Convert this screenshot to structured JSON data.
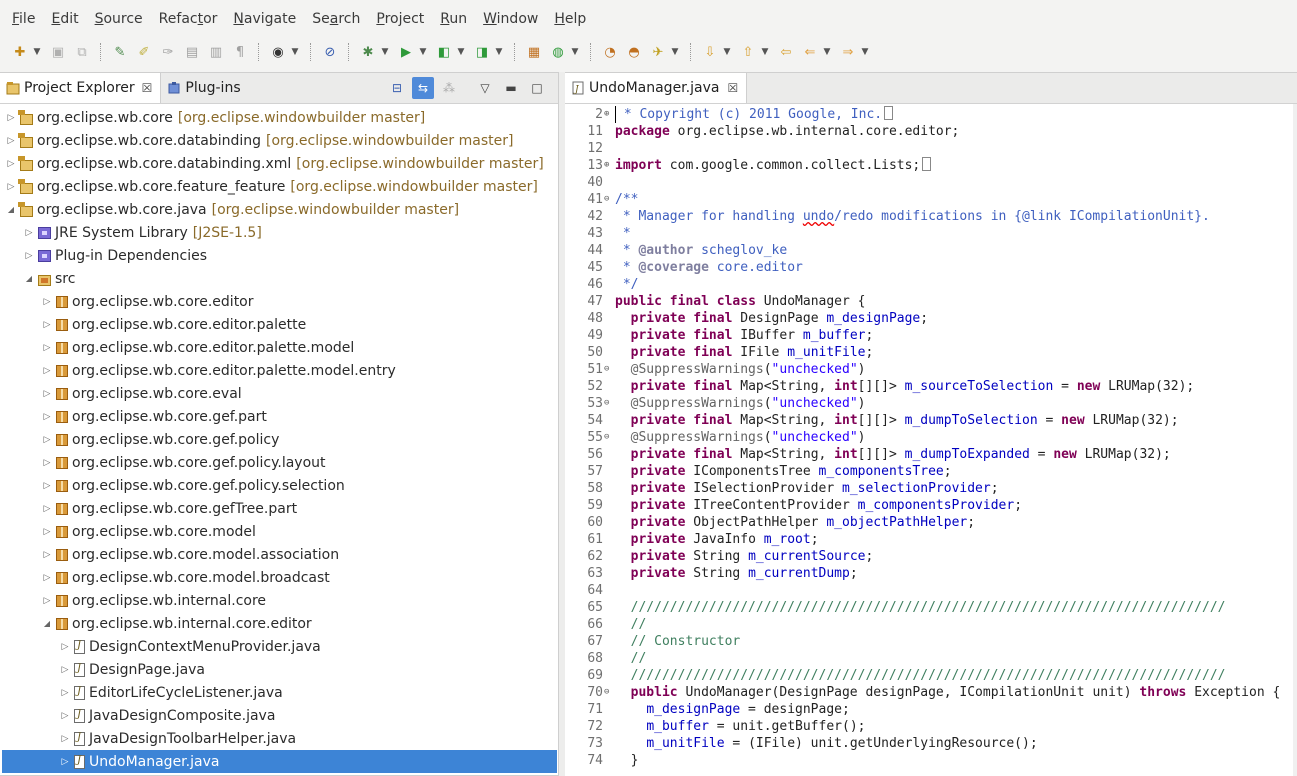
{
  "menubar": {
    "items": [
      {
        "before": "",
        "u": "F",
        "after": "ile"
      },
      {
        "before": "",
        "u": "E",
        "after": "dit"
      },
      {
        "before": "",
        "u": "S",
        "after": "ource"
      },
      {
        "before": "Refac",
        "u": "t",
        "after": "or"
      },
      {
        "before": "",
        "u": "N",
        "after": "avigate"
      },
      {
        "before": "Se",
        "u": "a",
        "after": "rch"
      },
      {
        "before": "",
        "u": "P",
        "after": "roject"
      },
      {
        "before": "",
        "u": "R",
        "after": "un"
      },
      {
        "before": "",
        "u": "W",
        "after": "indow"
      },
      {
        "before": "",
        "u": "H",
        "after": "elp"
      }
    ]
  },
  "left_view": {
    "tabs": [
      {
        "label": "Project Explorer",
        "icon": "project-explorer-icon",
        "active": true
      },
      {
        "label": "Plug-ins",
        "icon": "plugins-icon",
        "active": false
      }
    ],
    "tree": [
      {
        "depth": 0,
        "label": "org.eclipse.wb.core",
        "decoration": "[org.eclipse.windowbuilder master]",
        "icon": "project",
        "expanded": false
      },
      {
        "depth": 0,
        "label": "org.eclipse.wb.core.databinding",
        "decoration": "[org.eclipse.windowbuilder master]",
        "icon": "project",
        "expanded": false
      },
      {
        "depth": 0,
        "label": "org.eclipse.wb.core.databinding.xml",
        "decoration": "[org.eclipse.windowbuilder master]",
        "icon": "project",
        "expanded": false
      },
      {
        "depth": 0,
        "label": "org.eclipse.wb.core.feature_feature",
        "decoration": "[org.eclipse.windowbuilder master]",
        "icon": "project",
        "expanded": false
      },
      {
        "depth": 0,
        "label": "org.eclipse.wb.core.java",
        "decoration": "[org.eclipse.windowbuilder master]",
        "icon": "project",
        "expanded": true
      },
      {
        "depth": 1,
        "label": "JRE System Library",
        "decoration": "[J2SE-1.5]",
        "icon": "lib",
        "expanded": false
      },
      {
        "depth": 1,
        "label": "Plug-in Dependencies",
        "decoration": "",
        "icon": "lib",
        "expanded": false
      },
      {
        "depth": 1,
        "label": "src",
        "decoration": "",
        "icon": "src",
        "expanded": true
      },
      {
        "depth": 2,
        "label": "org.eclipse.wb.core.editor",
        "decoration": "",
        "icon": "pkg",
        "expanded": false
      },
      {
        "depth": 2,
        "label": "org.eclipse.wb.core.editor.palette",
        "decoration": "",
        "icon": "pkg",
        "expanded": false
      },
      {
        "depth": 2,
        "label": "org.eclipse.wb.core.editor.palette.model",
        "decoration": "",
        "icon": "pkg",
        "expanded": false
      },
      {
        "depth": 2,
        "label": "org.eclipse.wb.core.editor.palette.model.entry",
        "decoration": "",
        "icon": "pkg",
        "expanded": false
      },
      {
        "depth": 2,
        "label": "org.eclipse.wb.core.eval",
        "decoration": "",
        "icon": "pkg",
        "expanded": false
      },
      {
        "depth": 2,
        "label": "org.eclipse.wb.core.gef.part",
        "decoration": "",
        "icon": "pkg",
        "expanded": false
      },
      {
        "depth": 2,
        "label": "org.eclipse.wb.core.gef.policy",
        "decoration": "",
        "icon": "pkg",
        "expanded": false
      },
      {
        "depth": 2,
        "label": "org.eclipse.wb.core.gef.policy.layout",
        "decoration": "",
        "icon": "pkg",
        "expanded": false
      },
      {
        "depth": 2,
        "label": "org.eclipse.wb.core.gef.policy.selection",
        "decoration": "",
        "icon": "pkg",
        "expanded": false
      },
      {
        "depth": 2,
        "label": "org.eclipse.wb.core.gefTree.part",
        "decoration": "",
        "icon": "pkg",
        "expanded": false
      },
      {
        "depth": 2,
        "label": "org.eclipse.wb.core.model",
        "decoration": "",
        "icon": "pkg",
        "expanded": false
      },
      {
        "depth": 2,
        "label": "org.eclipse.wb.core.model.association",
        "decoration": "",
        "icon": "pkg",
        "expanded": false
      },
      {
        "depth": 2,
        "label": "org.eclipse.wb.core.model.broadcast",
        "decoration": "",
        "icon": "pkg",
        "expanded": false
      },
      {
        "depth": 2,
        "label": "org.eclipse.wb.internal.core",
        "decoration": "",
        "icon": "pkg",
        "expanded": false
      },
      {
        "depth": 2,
        "label": "org.eclipse.wb.internal.core.editor",
        "decoration": "",
        "icon": "pkg",
        "expanded": true
      },
      {
        "depth": 3,
        "label": "DesignContextMenuProvider.java",
        "decoration": "",
        "icon": "java",
        "expanded": false
      },
      {
        "depth": 3,
        "label": "DesignPage.java",
        "decoration": "",
        "icon": "java",
        "expanded": false
      },
      {
        "depth": 3,
        "label": "EditorLifeCycleListener.java",
        "decoration": "",
        "icon": "java",
        "expanded": false
      },
      {
        "depth": 3,
        "label": "JavaDesignComposite.java",
        "decoration": "",
        "icon": "java",
        "expanded": false
      },
      {
        "depth": 3,
        "label": "JavaDesignToolbarHelper.java",
        "decoration": "",
        "icon": "java",
        "expanded": false
      },
      {
        "depth": 3,
        "label": "UndoManager.java",
        "decoration": "",
        "icon": "java",
        "expanded": false,
        "selected": true
      }
    ]
  },
  "editor": {
    "tab": {
      "label": "UndoManager.java",
      "icon": "java-file-icon"
    },
    "lines": [
      {
        "n": "2",
        "fold": "⊕",
        "tokens": [
          [
            "cm",
            " * Copyright (c) 2011 Google, Inc."
          ],
          [
            "box",
            ""
          ]
        ]
      },
      {
        "n": "11",
        "fold": "",
        "tokens": [
          [
            "kw",
            "package"
          ],
          [
            "",
            " org.eclipse.wb.internal.core.editor;"
          ]
        ]
      },
      {
        "n": "12",
        "fold": "",
        "tokens": []
      },
      {
        "n": "13",
        "fold": "⊕",
        "tokens": [
          [
            "kw",
            "import"
          ],
          [
            "",
            " com.google.common.collect.Lists;"
          ],
          [
            "box",
            ""
          ]
        ]
      },
      {
        "n": "40",
        "fold": "",
        "tokens": []
      },
      {
        "n": "41",
        "fold": "⊖",
        "tokens": [
          [
            "cm",
            "/**"
          ]
        ]
      },
      {
        "n": "42",
        "fold": "",
        "tokens": [
          [
            "cm",
            " * Manager for handling "
          ],
          [
            "cmsq",
            "undo"
          ],
          [
            "cm",
            "/redo modifications in {@link ICompilationUnit}."
          ]
        ]
      },
      {
        "n": "43",
        "fold": "",
        "tokens": [
          [
            "cm",
            " *"
          ]
        ]
      },
      {
        "n": "44",
        "fold": "",
        "tokens": [
          [
            "cm",
            " * "
          ],
          [
            "tg",
            "@author"
          ],
          [
            "cm",
            " scheglov_ke"
          ]
        ]
      },
      {
        "n": "45",
        "fold": "",
        "tokens": [
          [
            "cm",
            " * "
          ],
          [
            "tg",
            "@coverage"
          ],
          [
            "cm",
            " core.editor"
          ]
        ]
      },
      {
        "n": "46",
        "fold": "",
        "tokens": [
          [
            "cm",
            " */"
          ]
        ]
      },
      {
        "n": "47",
        "fold": "",
        "tokens": [
          [
            "kw",
            "public"
          ],
          [
            "",
            " "
          ],
          [
            "kw",
            "final"
          ],
          [
            "",
            " "
          ],
          [
            "kw",
            "class"
          ],
          [
            "",
            " UndoManager {"
          ]
        ]
      },
      {
        "n": "48",
        "fold": "",
        "tokens": [
          [
            "",
            "  "
          ],
          [
            "kw",
            "private"
          ],
          [
            "",
            " "
          ],
          [
            "kw",
            "final"
          ],
          [
            "",
            " DesignPage "
          ],
          [
            "fd",
            "m_designPage"
          ],
          [
            "",
            ";"
          ]
        ]
      },
      {
        "n": "49",
        "fold": "",
        "tokens": [
          [
            "",
            "  "
          ],
          [
            "kw",
            "private"
          ],
          [
            "",
            " "
          ],
          [
            "kw",
            "final"
          ],
          [
            "",
            " IBuffer "
          ],
          [
            "fd",
            "m_buffer"
          ],
          [
            "",
            ";"
          ]
        ]
      },
      {
        "n": "50",
        "fold": "",
        "tokens": [
          [
            "",
            "  "
          ],
          [
            "kw",
            "private"
          ],
          [
            "",
            " "
          ],
          [
            "kw",
            "final"
          ],
          [
            "",
            " IFile "
          ],
          [
            "fd",
            "m_unitFile"
          ],
          [
            "",
            ";"
          ]
        ]
      },
      {
        "n": "51",
        "fold": "⊖",
        "tokens": [
          [
            "",
            "  "
          ],
          [
            "an",
            "@SuppressWarnings"
          ],
          [
            "",
            "("
          ],
          [
            "st",
            "\"unchecked\""
          ],
          [
            "",
            ")"
          ]
        ]
      },
      {
        "n": "52",
        "fold": "",
        "tokens": [
          [
            "",
            "  "
          ],
          [
            "kw",
            "private"
          ],
          [
            "",
            " "
          ],
          [
            "kw",
            "final"
          ],
          [
            "",
            " Map<String, "
          ],
          [
            "kw",
            "int"
          ],
          [
            "",
            "[][]> "
          ],
          [
            "fd",
            "m_sourceToSelection"
          ],
          [
            "",
            " = "
          ],
          [
            "kw",
            "new"
          ],
          [
            "",
            " LRUMap(32);"
          ]
        ]
      },
      {
        "n": "53",
        "fold": "⊖",
        "tokens": [
          [
            "",
            "  "
          ],
          [
            "an",
            "@SuppressWarnings"
          ],
          [
            "",
            "("
          ],
          [
            "st",
            "\"unchecked\""
          ],
          [
            "",
            ")"
          ]
        ]
      },
      {
        "n": "54",
        "fold": "",
        "tokens": [
          [
            "",
            "  "
          ],
          [
            "kw",
            "private"
          ],
          [
            "",
            " "
          ],
          [
            "kw",
            "final"
          ],
          [
            "",
            " Map<String, "
          ],
          [
            "kw",
            "int"
          ],
          [
            "",
            "[][]> "
          ],
          [
            "fd",
            "m_dumpToSelection"
          ],
          [
            "",
            " = "
          ],
          [
            "kw",
            "new"
          ],
          [
            "",
            " LRUMap(32);"
          ]
        ]
      },
      {
        "n": "55",
        "fold": "⊖",
        "tokens": [
          [
            "",
            "  "
          ],
          [
            "an",
            "@SuppressWarnings"
          ],
          [
            "",
            "("
          ],
          [
            "st",
            "\"unchecked\""
          ],
          [
            "",
            ")"
          ]
        ]
      },
      {
        "n": "56",
        "fold": "",
        "tokens": [
          [
            "",
            "  "
          ],
          [
            "kw",
            "private"
          ],
          [
            "",
            " "
          ],
          [
            "kw",
            "final"
          ],
          [
            "",
            " Map<String, "
          ],
          [
            "kw",
            "int"
          ],
          [
            "",
            "[][]> "
          ],
          [
            "fd",
            "m_dumpToExpanded"
          ],
          [
            "",
            " = "
          ],
          [
            "kw",
            "new"
          ],
          [
            "",
            " LRUMap(32);"
          ]
        ]
      },
      {
        "n": "57",
        "fold": "",
        "tokens": [
          [
            "",
            "  "
          ],
          [
            "kw",
            "private"
          ],
          [
            "",
            " IComponentsTree "
          ],
          [
            "fd",
            "m_componentsTree"
          ],
          [
            "",
            ";"
          ]
        ]
      },
      {
        "n": "58",
        "fold": "",
        "tokens": [
          [
            "",
            "  "
          ],
          [
            "kw",
            "private"
          ],
          [
            "",
            " ISelectionProvider "
          ],
          [
            "fd",
            "m_selectionProvider"
          ],
          [
            "",
            ";"
          ]
        ]
      },
      {
        "n": "59",
        "fold": "",
        "tokens": [
          [
            "",
            "  "
          ],
          [
            "kw",
            "private"
          ],
          [
            "",
            " ITreeContentProvider "
          ],
          [
            "fd",
            "m_componentsProvider"
          ],
          [
            "",
            ";"
          ]
        ]
      },
      {
        "n": "60",
        "fold": "",
        "tokens": [
          [
            "",
            "  "
          ],
          [
            "kw",
            "private"
          ],
          [
            "",
            " ObjectPathHelper "
          ],
          [
            "fd",
            "m_objectPathHelper"
          ],
          [
            "",
            ";"
          ]
        ]
      },
      {
        "n": "61",
        "fold": "",
        "tokens": [
          [
            "",
            "  "
          ],
          [
            "kw",
            "private"
          ],
          [
            "",
            " JavaInfo "
          ],
          [
            "fd",
            "m_root"
          ],
          [
            "",
            ";"
          ]
        ]
      },
      {
        "n": "62",
        "fold": "",
        "tokens": [
          [
            "",
            "  "
          ],
          [
            "kw",
            "private"
          ],
          [
            "",
            " String "
          ],
          [
            "fd",
            "m_currentSource"
          ],
          [
            "",
            ";"
          ]
        ]
      },
      {
        "n": "63",
        "fold": "",
        "tokens": [
          [
            "",
            "  "
          ],
          [
            "kw",
            "private"
          ],
          [
            "",
            " String "
          ],
          [
            "fd",
            "m_currentDump"
          ],
          [
            "",
            ";"
          ]
        ]
      },
      {
        "n": "64",
        "fold": "",
        "tokens": []
      },
      {
        "n": "65",
        "fold": "",
        "tokens": [
          [
            "lc",
            "  ////////////////////////////////////////////////////////////////////////////"
          ]
        ]
      },
      {
        "n": "66",
        "fold": "",
        "tokens": [
          [
            "lc",
            "  //"
          ]
        ]
      },
      {
        "n": "67",
        "fold": "",
        "tokens": [
          [
            "lc",
            "  // Constructor"
          ]
        ]
      },
      {
        "n": "68",
        "fold": "",
        "tokens": [
          [
            "lc",
            "  //"
          ]
        ]
      },
      {
        "n": "69",
        "fold": "",
        "tokens": [
          [
            "lc",
            "  ////////////////////////////////////////////////////////////////////////////"
          ]
        ]
      },
      {
        "n": "70",
        "fold": "⊖",
        "tokens": [
          [
            "",
            "  "
          ],
          [
            "kw",
            "public"
          ],
          [
            "",
            " UndoManager(DesignPage designPage, ICompilationUnit unit) "
          ],
          [
            "kw",
            "throws"
          ],
          [
            "",
            " Exception {"
          ]
        ]
      },
      {
        "n": "71",
        "fold": "",
        "tokens": [
          [
            "",
            "    "
          ],
          [
            "fd",
            "m_designPage"
          ],
          [
            "",
            " = designPage;"
          ]
        ]
      },
      {
        "n": "72",
        "fold": "",
        "tokens": [
          [
            "",
            "    "
          ],
          [
            "fd",
            "m_buffer"
          ],
          [
            "",
            " = unit.getBuffer();"
          ]
        ]
      },
      {
        "n": "73",
        "fold": "",
        "tokens": [
          [
            "",
            "    "
          ],
          [
            "fd",
            "m_unitFile"
          ],
          [
            "",
            " = (IFile) unit.getUnderlyingResource();"
          ]
        ]
      },
      {
        "n": "74",
        "fold": "",
        "tokens": [
          [
            "",
            "  }"
          ]
        ]
      }
    ]
  }
}
